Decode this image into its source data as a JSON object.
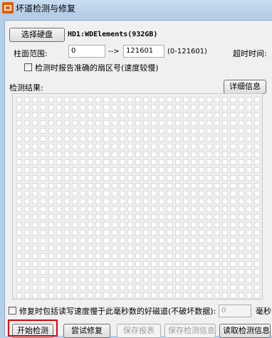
{
  "window": {
    "title": "坏道检测与修复"
  },
  "disk": {
    "select_button": "选择硬盘",
    "selected": "HD1:WDElements(932GB)"
  },
  "range": {
    "label": "柱面范围:",
    "start": "0",
    "arrow": "-->",
    "end": "121601",
    "hint": "(0-121601)"
  },
  "timeout": {
    "label": "超时时间:"
  },
  "report_sector": {
    "label": "检测时报告准确的扇区号(速度较慢)",
    "checked": false
  },
  "result": {
    "label": "检测结果:",
    "details_button": "详细信息"
  },
  "repair_option": {
    "label": "修复时包括读写速度慢于此毫秒数的好磁道(不破坏数据):",
    "value": "0",
    "unit": "毫秒",
    "checked": false
  },
  "actions": {
    "start": "开始检测",
    "try_repair": "尝试修复",
    "save_report": "保存报表",
    "save_info": "保存检测信息",
    "read_info": "读取检测信息"
  }
}
